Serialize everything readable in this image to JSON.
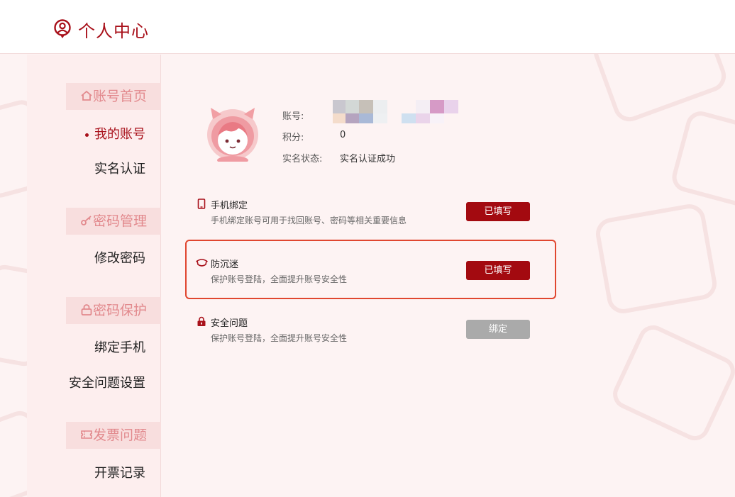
{
  "header": {
    "title": "个人中心"
  },
  "sidebar": {
    "sections": [
      {
        "title": "账号首页",
        "items": [
          {
            "label": "我的账号",
            "active": true
          },
          {
            "label": "实名认证"
          }
        ]
      },
      {
        "title": "密码管理",
        "items": [
          {
            "label": "修改密码"
          }
        ]
      },
      {
        "title": "密码保护",
        "items": [
          {
            "label": "绑定手机"
          },
          {
            "label": "安全问题设置"
          }
        ]
      },
      {
        "title": "发票问题",
        "items": [
          {
            "label": "开票记录"
          }
        ]
      }
    ]
  },
  "profile": {
    "account_label": "账号:",
    "points_label": "积分:",
    "points_value": "0",
    "realname_label": "实名状态:",
    "realname_value": "实名认证成功"
  },
  "security": {
    "rows": [
      {
        "title": "手机绑定",
        "desc": "手机绑定账号可用于找回账号、密码等相关重要信息",
        "button": "已填写",
        "icon": "phone-icon"
      },
      {
        "title": "防沉迷",
        "desc": "保护账号登陆，全面提升账号安全性",
        "button": "已填写",
        "icon": "mask-icon"
      },
      {
        "title": "安全问题",
        "desc": "保护账号登陆，全面提升账号安全性",
        "button": "绑定",
        "icon": "lock-icon"
      }
    ]
  },
  "colors": {
    "brand": "#a8101a",
    "button_red": "#a30a10",
    "button_gray": "#aaaaaa",
    "highlight": "#e0462f"
  }
}
